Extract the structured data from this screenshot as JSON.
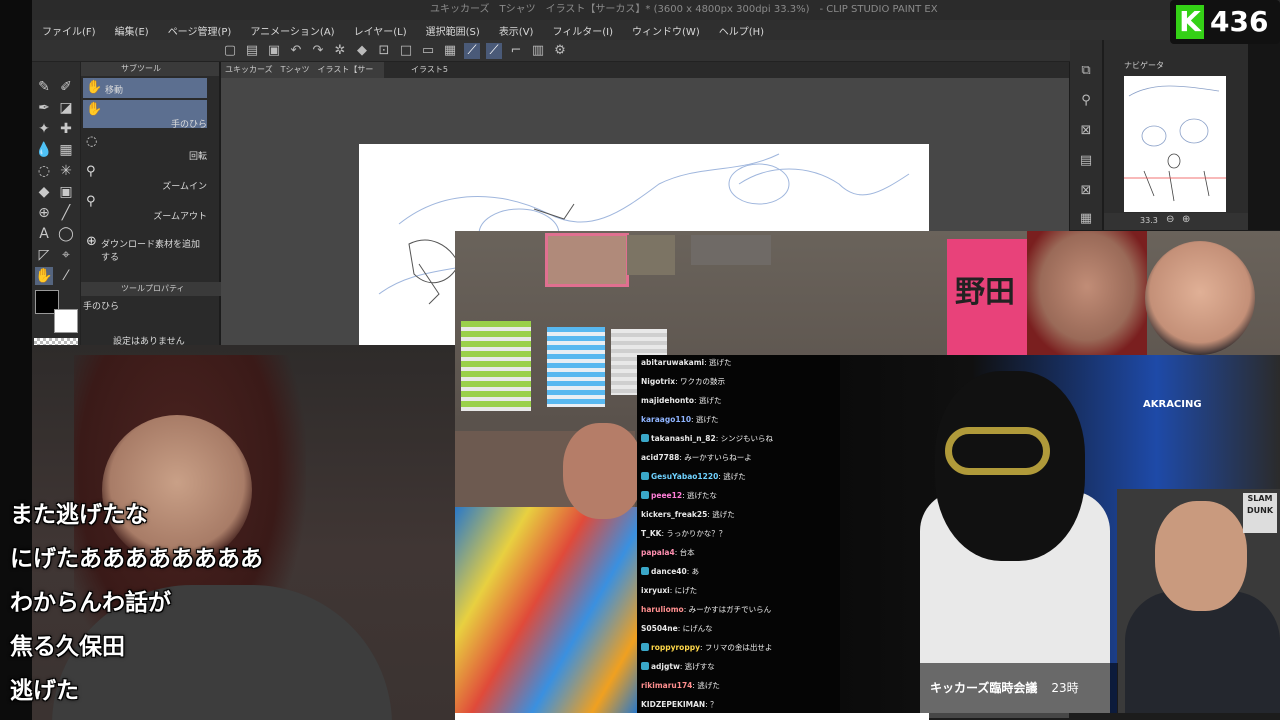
{
  "titlebar": {
    "text": "ユキッカーズ　Tシャツ　イラスト【サーカス】* (3600 x 4800px 300dpi 33.3%)　- CLIP STUDIO PAINT EX"
  },
  "menu": [
    "ファイル(F)",
    "編集(E)",
    "ページ管理(P)",
    "アニメーション(A)",
    "レイヤー(L)",
    "選択範囲(S)",
    "表示(V)",
    "フィルター(I)",
    "ウィンドウ(W)",
    "ヘルプ(H)"
  ],
  "logo": {
    "letter": "K",
    "number": "436",
    "color": "#34d116"
  },
  "subtool": {
    "header": "サブツール",
    "items": [
      {
        "left": "移動",
        "right": "",
        "icon": "hand-icon"
      },
      {
        "left": "",
        "right": "手のひら",
        "icon": "hand-icon"
      },
      {
        "left": "",
        "right": "回転",
        "icon": "rotate-icon"
      },
      {
        "left": "",
        "right": "ズームイン",
        "icon": "zoom-in-icon"
      },
      {
        "left": "",
        "right": "ズームアウト",
        "icon": "zoom-out-icon"
      },
      {
        "left": "ダウンロード素材を追加する",
        "right": "",
        "icon": "plus-icon"
      }
    ]
  },
  "toolprop": {
    "header": "ツールプロパティ",
    "tool_name": "手のひら",
    "empty_text": "設定はありません"
  },
  "tabs": [
    {
      "label": "ユキッカーズ　Tシャツ　イラスト【サーカス】*"
    },
    {
      "label": "イラスト5"
    }
  ],
  "navigator": {
    "header": "ナビゲータ",
    "zoom": "33.3"
  },
  "subtitles": [
    "また逃げたな",
    "にげたああああああああ",
    "わからんわ話が",
    "焦る久保田",
    "逃げた"
  ],
  "stream": {
    "banner_text": "野田",
    "chair_brand": "AKRACING",
    "poster_text": "SLAM DUNK",
    "caption_title": "キッカーズ臨時会議",
    "caption_time": "23時"
  },
  "chat": [
    {
      "name": "abitaruwakami",
      "msg": ": 逃げた",
      "color": "#e8e8e8",
      "icon": false
    },
    {
      "name": "Nigotrix",
      "msg": ": ワクカの鼓示",
      "color": "#e8e8e8",
      "icon": false
    },
    {
      "name": "majidehonto",
      "msg": ": 逃げた",
      "color": "#e8e8e8",
      "icon": false
    },
    {
      "name": "karaago110",
      "msg": ": 逃げた",
      "color": "#8fb4ff",
      "icon": false
    },
    {
      "name": "takanashi_n_82",
      "msg": ": シンジもいらね",
      "color": "#e8e8e8",
      "icon": true
    },
    {
      "name": "acid7788",
      "msg": ": みーかすいらねーよ",
      "color": "#e8e8e8",
      "icon": false
    },
    {
      "name": "GesuYabao1220",
      "msg": ": 逃げた",
      "color": "#6fd2ff",
      "icon": true
    },
    {
      "name": "peee12",
      "msg": ": 逃げたな",
      "color": "#ff7fd8",
      "icon": true
    },
    {
      "name": "kickers_freak25",
      "msg": ": 逃げた",
      "color": "#e8e8e8",
      "icon": false
    },
    {
      "name": "T_KK",
      "msg": ": うっかりかな？？",
      "color": "#e8e8e8",
      "icon": false
    },
    {
      "name": "papala4",
      "msg": ": 台本",
      "color": "#ff8fb0",
      "icon": false
    },
    {
      "name": "dance40",
      "msg": ": あ",
      "color": "#e8e8e8",
      "icon": true
    },
    {
      "name": "ixryuxi",
      "msg": ": にげた",
      "color": "#e8e8e8",
      "icon": false
    },
    {
      "name": "haruliomo",
      "msg": ": みーかすはガチでいらん",
      "color": "#ff8f8f",
      "icon": false
    },
    {
      "name": "S0504ne",
      "msg": ": にげんな",
      "color": "#e8e8e8",
      "icon": false
    },
    {
      "name": "roppyroppy",
      "msg": ": フリマの金は出せよ",
      "color": "#ffd84a",
      "icon": true
    },
    {
      "name": "adjgtw",
      "msg": ": 逃げすな",
      "color": "#e8e8e8",
      "icon": true
    },
    {
      "name": "rikimaru174",
      "msg": ": 逃げた",
      "color": "#ff8f8f",
      "icon": false
    },
    {
      "name": "KIDZEPEKIMAN",
      "msg": ": ？",
      "color": "#e8e8e8",
      "icon": false
    }
  ]
}
